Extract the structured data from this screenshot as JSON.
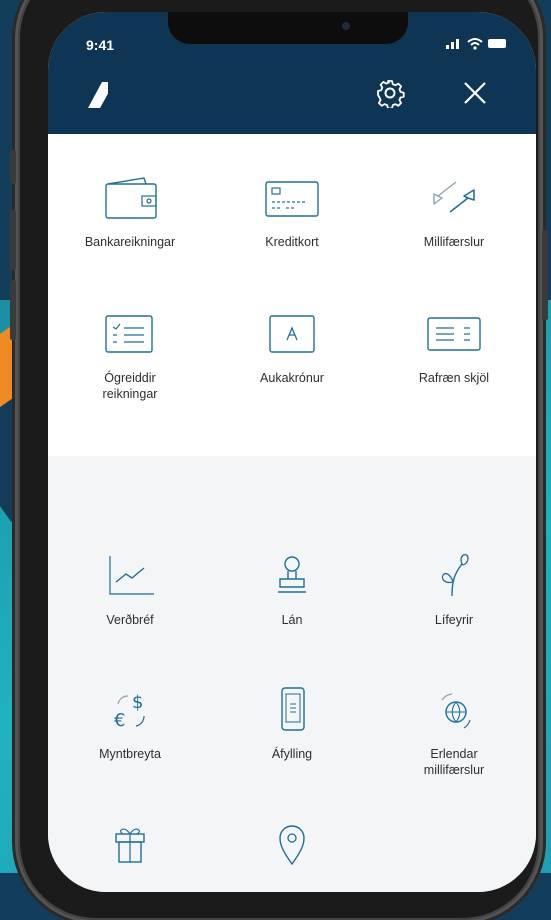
{
  "status": {
    "time": "9:41"
  },
  "header": {
    "logo_icon": "bank-logo-icon",
    "settings_icon": "gear-icon",
    "close_icon": "close-icon"
  },
  "menu_primary": [
    {
      "label": "Bankareikningar",
      "icon": "wallet-icon"
    },
    {
      "label": "Kreditkort",
      "icon": "credit-card-icon"
    },
    {
      "label": "Millifærslur",
      "icon": "transfer-arrows-icon"
    },
    {
      "label_lines": [
        "Ógreiddir",
        "reikningar"
      ],
      "icon": "bill-list-icon"
    },
    {
      "label": "Aukakrónur",
      "icon": "bonus-card-icon"
    },
    {
      "label": "Rafræn skjöl",
      "icon": "document-icon"
    }
  ],
  "menu_secondary": [
    {
      "label": "Verðbréf",
      "icon": "line-chart-icon"
    },
    {
      "label": "Lán",
      "icon": "stamp-icon"
    },
    {
      "label": "Lífeyrir",
      "icon": "plant-icon"
    },
    {
      "label": "Myntbreyta",
      "icon": "currency-exchange-icon"
    },
    {
      "label": "Áfylling",
      "icon": "phone-topup-icon"
    },
    {
      "label_lines": [
        "Erlendar",
        "millifærslur"
      ],
      "icon": "globe-transfer-icon"
    },
    {
      "label": "",
      "icon": "gift-icon"
    },
    {
      "label": "",
      "icon": "location-pin-icon"
    }
  ],
  "colors": {
    "navy": "#0e3553",
    "icon_blue": "#1f6f99",
    "teal": "#1fb3bf",
    "orange": "#f08a23"
  }
}
